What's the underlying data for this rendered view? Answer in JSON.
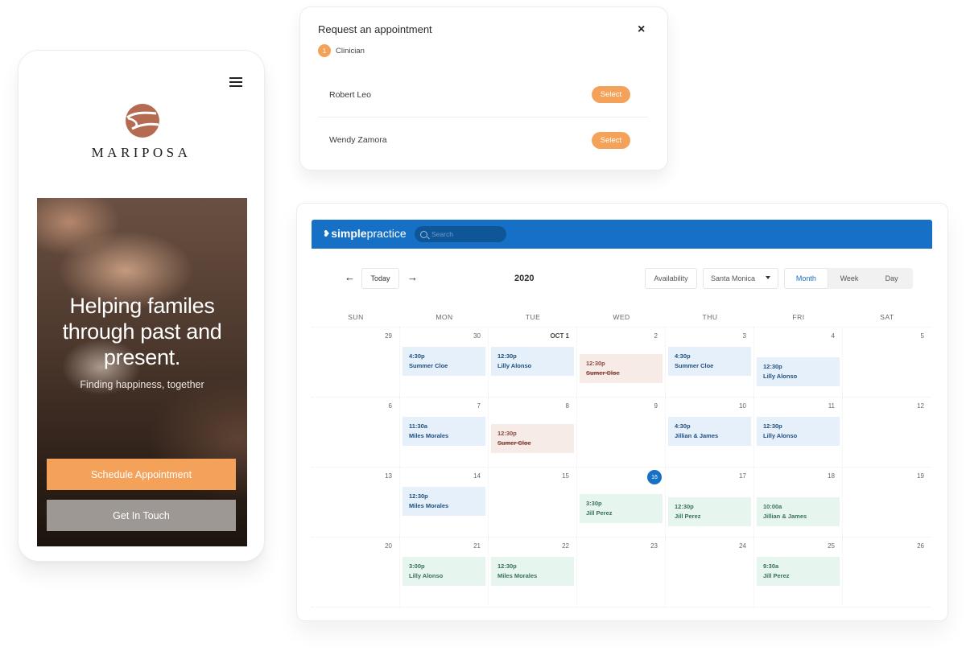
{
  "phone": {
    "brand": "MARIPOSA",
    "hero_title_lines": [
      "Helping familes",
      "through past and",
      "present."
    ],
    "hero_subtitle": "Finding happiness, together",
    "primary_button": "Schedule  Appointment",
    "secondary_button": "Get In Touch",
    "colors": {
      "accent": "#f4a25a",
      "secondary": "#9e9894",
      "logo": "#b56a52"
    }
  },
  "modal": {
    "title": "Request an appointment",
    "close_icon": "×",
    "step_number": "1",
    "step_label": "Clinician",
    "clinicians": [
      {
        "name": "Robert Leo",
        "action": "Select"
      },
      {
        "name": "Wendy Zamora",
        "action": "Select"
      }
    ]
  },
  "calendar": {
    "brand_bold": "simple",
    "brand_light": "practice",
    "search_placeholder": "Search",
    "today_label": "Today",
    "prev_icon": "←",
    "next_icon": "→",
    "year": "2020",
    "availability_label": "Availability",
    "location": "Santa Monica",
    "views": [
      "Month",
      "Week",
      "Day"
    ],
    "active_view": "Month",
    "weekdays": [
      "SUN",
      "MON",
      "TUE",
      "WED",
      "THU",
      "FRI",
      "SAT"
    ],
    "today_date": "16",
    "colors": {
      "header": "#1570c6",
      "scheduled": "#e5f0fa",
      "cancelled": "#f7ebe8",
      "confirmed": "#e6f6ef"
    },
    "weeks": [
      [
        {
          "date": "29",
          "events": []
        },
        {
          "date": "30",
          "events": [
            {
              "time": "4:30p",
              "name": "Summer Cloe",
              "status": "blue",
              "slot": 0
            }
          ]
        },
        {
          "date": "OCT 1",
          "bold": true,
          "events": [
            {
              "time": "12:30p",
              "name": "Lilly Alonso",
              "status": "blue",
              "slot": 0
            }
          ]
        },
        {
          "date": "2",
          "events": [
            {
              "time": "12:30p",
              "name": "Sumer Cloe",
              "status": "pink",
              "slot": 1
            }
          ]
        },
        {
          "date": "3",
          "events": [
            {
              "time": "4:30p",
              "name": "Summer Cloe",
              "status": "blue",
              "slot": 0
            }
          ]
        },
        {
          "date": "4",
          "events": [
            {
              "time": "12:30p",
              "name": "Lilly Alonso",
              "status": "blue",
              "slot": 2
            }
          ]
        },
        {
          "date": "5",
          "events": []
        }
      ],
      [
        {
          "date": "6",
          "events": []
        },
        {
          "date": "7",
          "events": [
            {
              "time": "11:30a",
              "name": "Miles Morales",
              "status": "blue",
              "slot": 0
            }
          ]
        },
        {
          "date": "8",
          "events": [
            {
              "time": "12:30p",
              "name": "Sumer Cloe",
              "status": "pink",
              "slot": 1
            }
          ]
        },
        {
          "date": "9",
          "events": []
        },
        {
          "date": "10",
          "events": [
            {
              "time": "4:30p",
              "name": "Jillian & James",
              "status": "blue",
              "slot": 0
            }
          ]
        },
        {
          "date": "11",
          "events": [
            {
              "time": "12:30p",
              "name": "Lilly Alonso",
              "status": "blue",
              "slot": 0
            }
          ]
        },
        {
          "date": "12",
          "events": []
        }
      ],
      [
        {
          "date": "13",
          "events": []
        },
        {
          "date": "14",
          "events": [
            {
              "time": "12:30p",
              "name": "Miles Morales",
              "status": "blue",
              "slot": 0
            }
          ]
        },
        {
          "date": "15",
          "events": []
        },
        {
          "date": "16",
          "today": true,
          "events": [
            {
              "time": "3:30p",
              "name": "Jill Perez",
              "status": "green",
              "slot": 1
            }
          ]
        },
        {
          "date": "17",
          "events": [
            {
              "time": "12:30p",
              "name": "Jill Perez",
              "status": "green",
              "slot": 2
            }
          ]
        },
        {
          "date": "18",
          "events": [
            {
              "time": "10:00a",
              "name": "Jillian & James",
              "status": "green",
              "slot": 2
            }
          ]
        },
        {
          "date": "19",
          "events": []
        }
      ],
      [
        {
          "date": "20",
          "events": []
        },
        {
          "date": "21",
          "events": [
            {
              "time": "3:00p",
              "name": "Lilly Alonso",
              "status": "green",
              "slot": 0
            }
          ]
        },
        {
          "date": "22",
          "events": [
            {
              "time": "12:30p",
              "name": "Miles Morales",
              "status": "green",
              "slot": 0
            }
          ]
        },
        {
          "date": "23",
          "events": []
        },
        {
          "date": "24",
          "events": []
        },
        {
          "date": "25",
          "events": [
            {
              "time": "9:30a",
              "name": "Jill Perez",
              "status": "green",
              "slot": 0
            }
          ]
        },
        {
          "date": "26",
          "events": []
        }
      ]
    ]
  }
}
